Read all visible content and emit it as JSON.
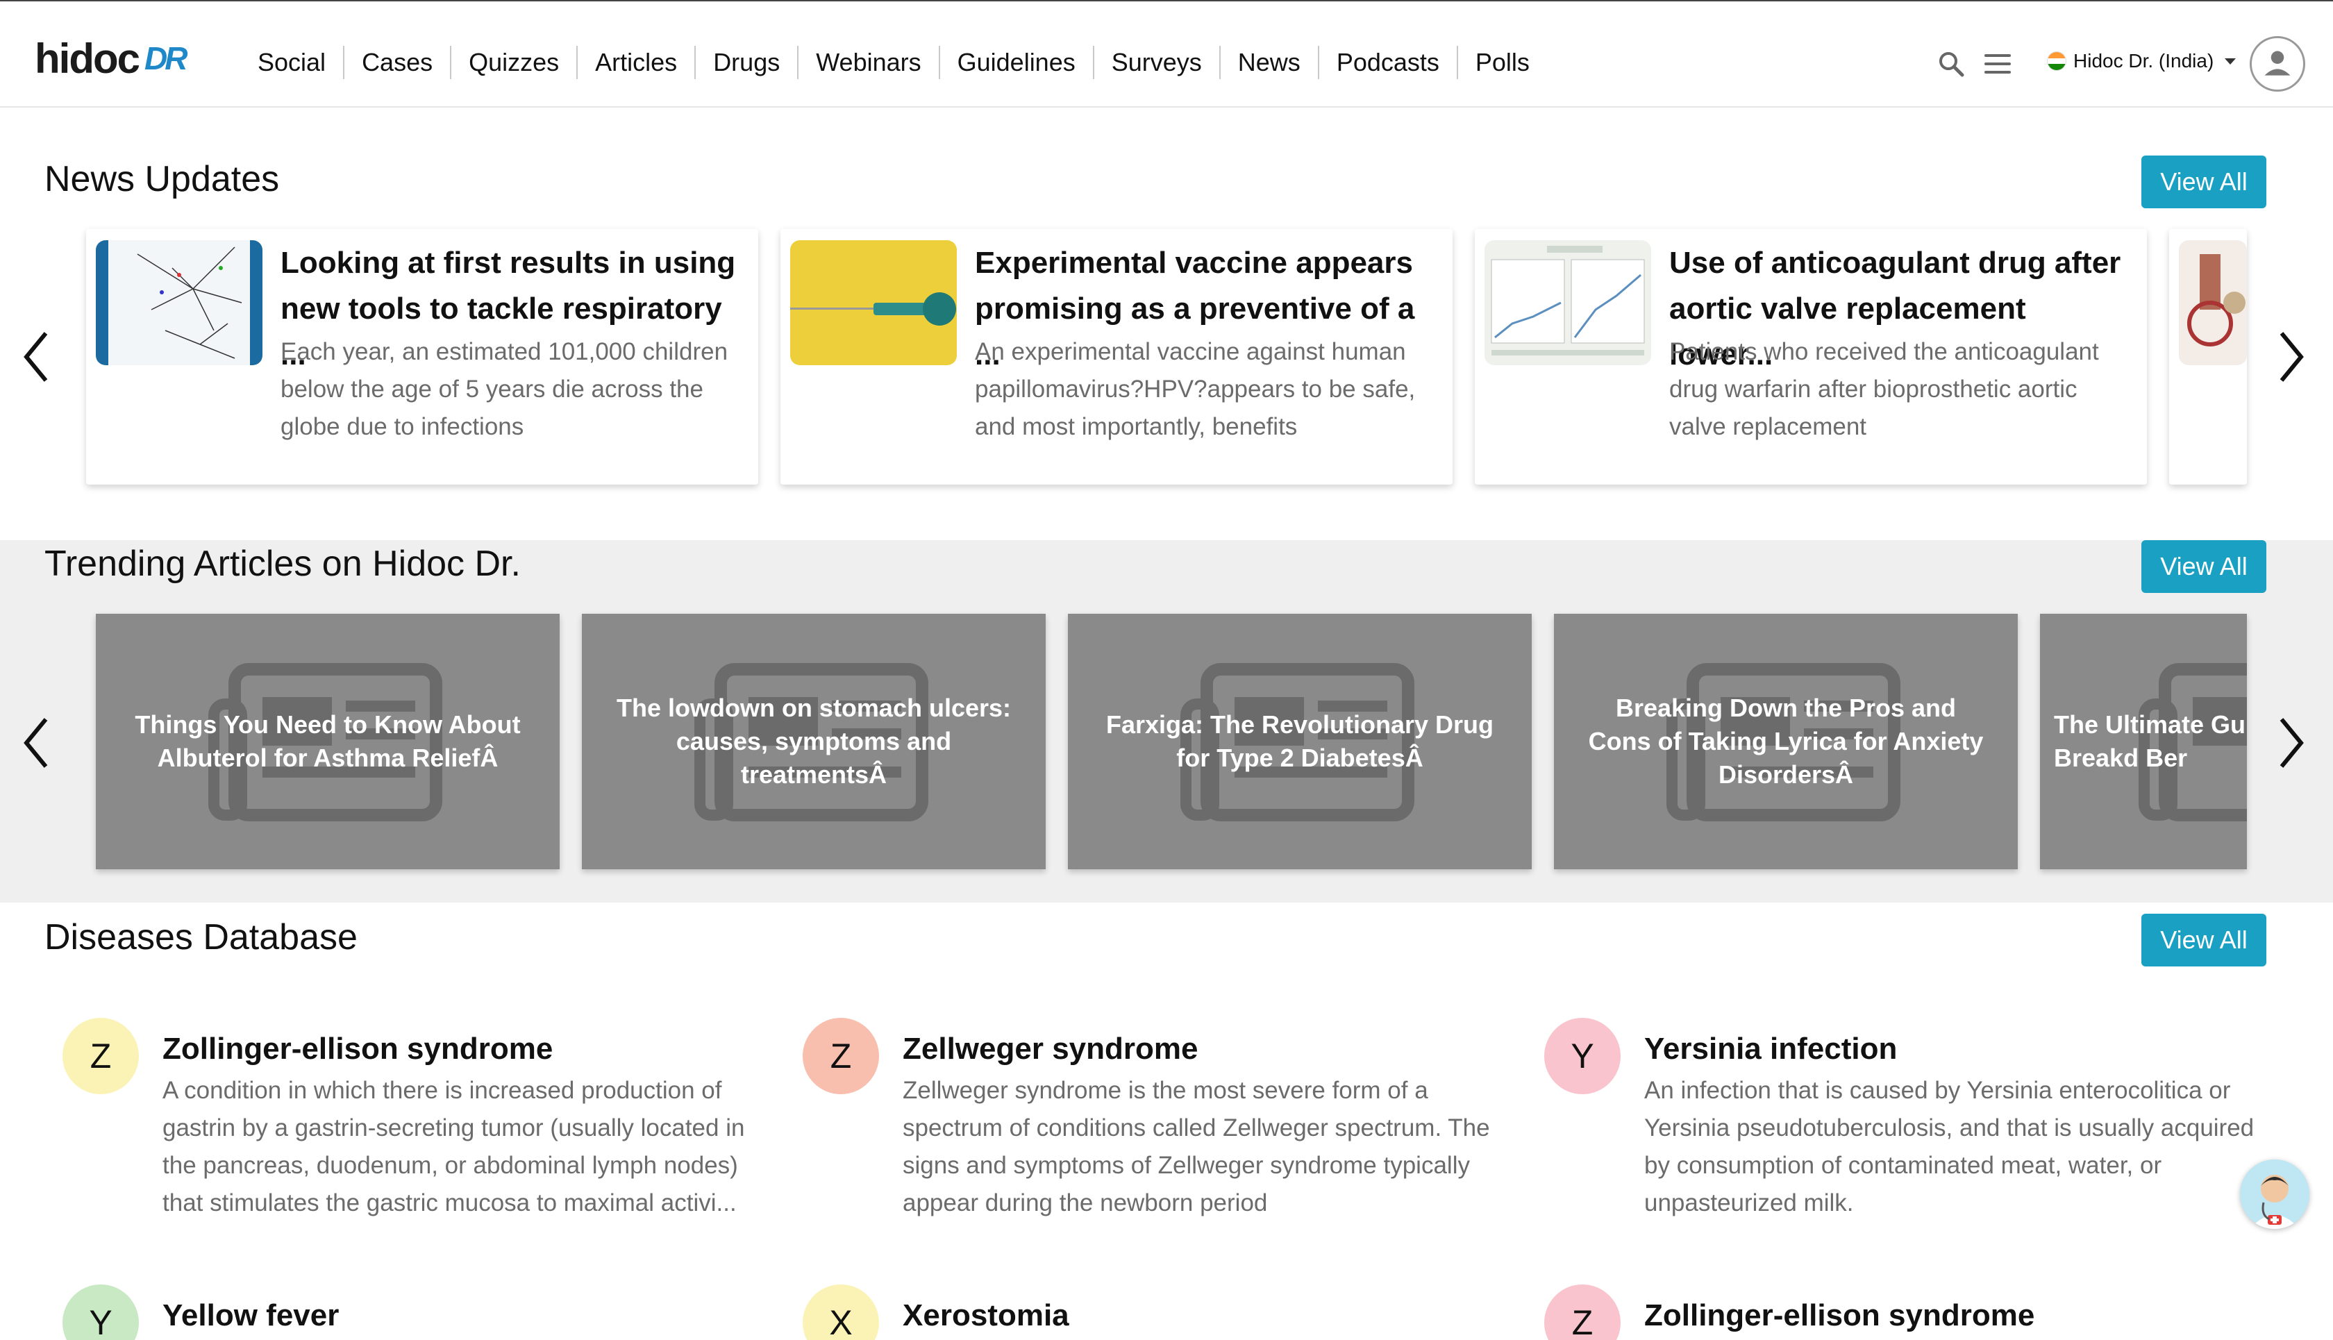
{
  "header": {
    "logo_text": "hidoc",
    "logo_suffix": "DR",
    "nav": [
      "Social",
      "Cases",
      "Quizzes",
      "Articles",
      "Drugs",
      "Webinars",
      "Guidelines",
      "Surveys",
      "News",
      "Podcasts",
      "Polls"
    ],
    "locale_label": "Hidoc Dr. (India)"
  },
  "news": {
    "title": "News Updates",
    "view_all": "View All",
    "cards": [
      {
        "title": "Looking at first results in using new tools to tackle respiratory ...",
        "desc": "Each year, an estimated 101,000 children below the age of 5 years die across the globe due to infections"
      },
      {
        "title": "Experimental vaccine appears promising as a preventive of a ...",
        "desc": "An experimental vaccine against human papillomavirus?HPV?appears to be safe, and most importantly, benefits"
      },
      {
        "title": "Use of anticoagulant drug after aortic valve replacement lower...",
        "desc": "Patients who received the anticoagulant drug warfarin after bioprosthetic aortic valve replacement"
      }
    ]
  },
  "trending": {
    "title": "Trending Articles on Hidoc Dr.",
    "view_all": "View All",
    "cards": [
      "Things You Need to Know About Albuterol for Asthma ReliefÂ",
      "The lowdown on stomach ulcers: causes, symptoms and treatmentsÂ",
      "Farxiga: The Revolutionary Drug for Type 2 DiabetesÂ",
      "Breaking Down the Pros and Cons of Taking Lyrica for Anxiety DisordersÂ",
      "The Ultimate Gui Biotin: A Breakd Ber"
    ]
  },
  "diseases": {
    "title": "Diseases Database",
    "view_all": "View All",
    "items": [
      {
        "letter": "Z",
        "name": "Zollinger-ellison syndrome",
        "desc": "A condition in which there is increased production of gastrin by a gastrin-secreting tumor (usually located in the pancreas, duodenum, or abdominal lymph nodes) that stimulates the gastric mucosa to maximal activi...",
        "color": "#fbf3b6"
      },
      {
        "letter": "Z",
        "name": "Zellweger syndrome",
        "desc": "Zellweger syndrome is the most severe form of a spectrum of conditions called Zellweger spectrum. The signs and symptoms of Zellweger syndrome typically appear during the newborn period",
        "color": "#f9bfae"
      },
      {
        "letter": "Y",
        "name": "Yersinia infection",
        "desc": "An infection that is caused by Yersinia enterocolitica or Yersinia pseudotuberculosis, and that is usually acquired by consumption of contaminated meat, water, or unpasteurized milk.",
        "color": "#f9c4cd"
      },
      {
        "letter": "Y",
        "name": "Yellow fever",
        "desc": "",
        "color": "#c9e9c4"
      },
      {
        "letter": "X",
        "name": "Xerostomia",
        "desc": "",
        "color": "#fbf3b6"
      },
      {
        "letter": "Z",
        "name": "Zollinger-ellison syndrome",
        "desc": "",
        "color": "#f9c4cd"
      }
    ]
  }
}
